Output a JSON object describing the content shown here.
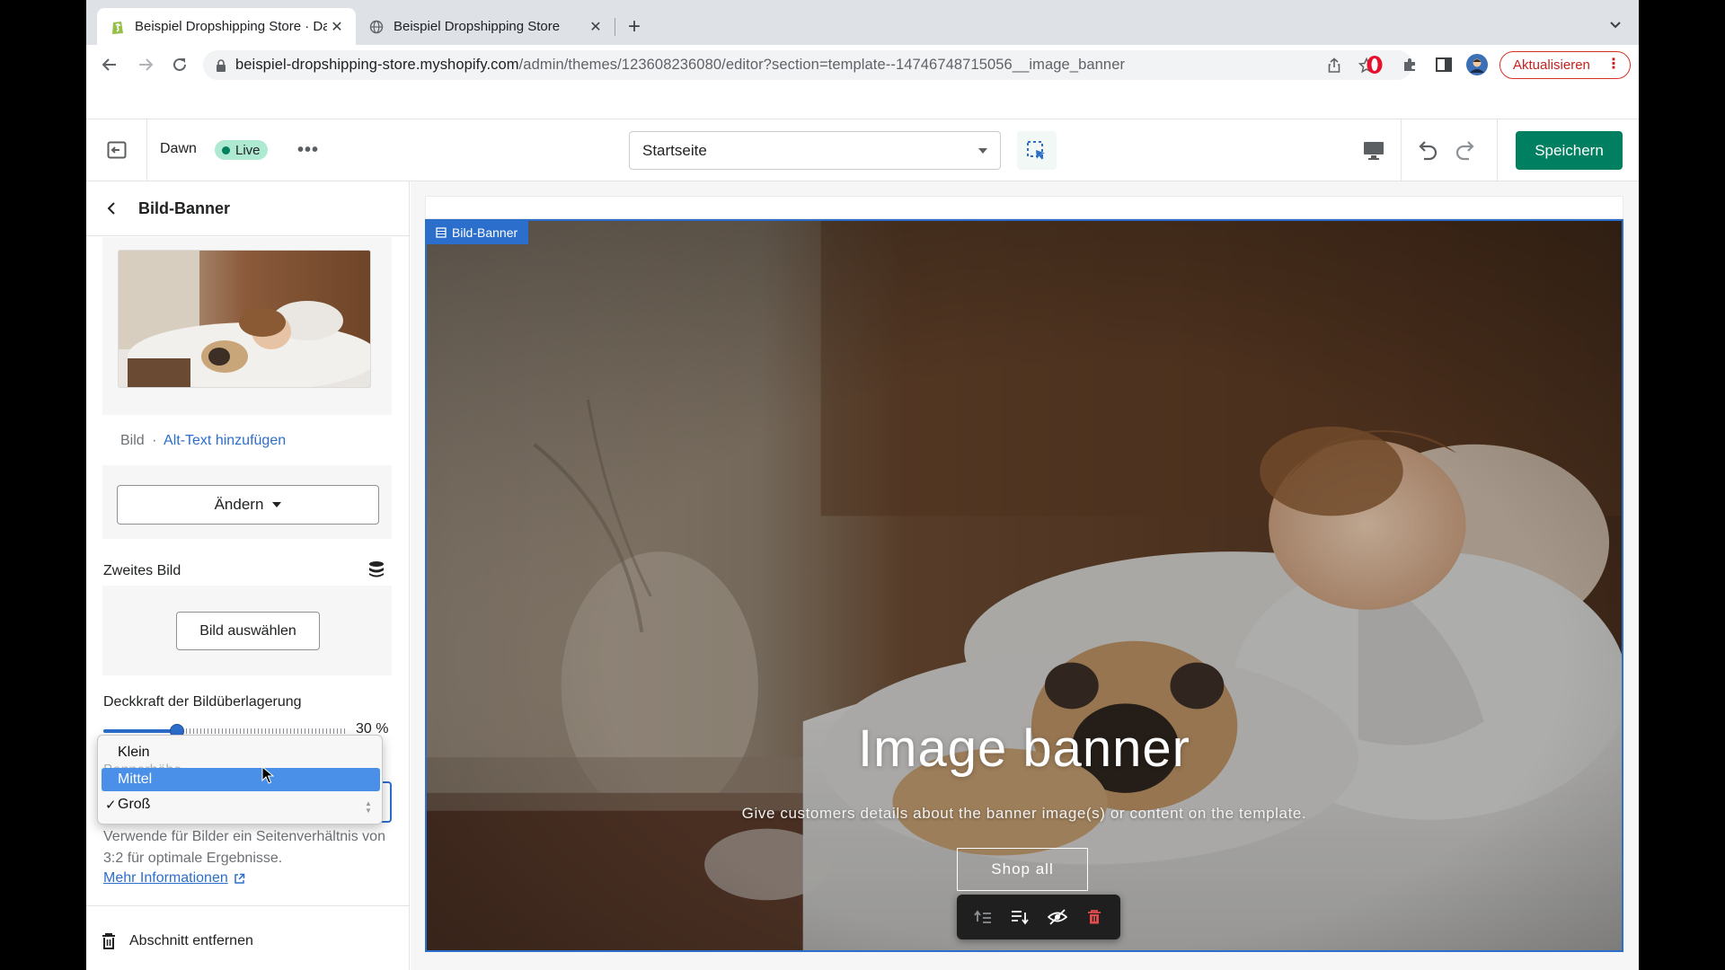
{
  "browser": {
    "tabs": [
      {
        "title": "Beispiel Dropshipping Store · Dawn",
        "active": true
      },
      {
        "title": "Beispiel Dropshipping Store",
        "active": false
      }
    ],
    "url_host": "beispiel-dropshipping-store.myshopify.com",
    "url_path": "/admin/themes/123608236080/editor?section=template--14746748715056__image_banner",
    "update_label": "Aktualisieren"
  },
  "editor": {
    "theme_name": "Dawn",
    "live_label": "Live",
    "page_select_value": "Startseite",
    "save_label": "Speichern"
  },
  "sidebar": {
    "title": "Bild-Banner",
    "image_meta_label": "Bild",
    "image_meta_sep": "·",
    "alt_text_link": "Alt-Text hinzufügen",
    "change_button": "Ändern",
    "second_image_label": "Zweites Bild",
    "select_image_button": "Bild auswählen",
    "opacity_label": "Deckkraft der Bildüberlagerung",
    "opacity_value_text": "30 %",
    "opacity_fraction": 0.3,
    "height_label": "Bannerhöhe",
    "height_help": "Verwende für Bilder ein Seitenverhältnis von 3:2 für optimale Ergebnisse.",
    "more_info_link": "Mehr Informationen",
    "remove_section": "Abschnitt entfernen"
  },
  "dropdown": {
    "options": [
      "Klein",
      "Mittel",
      "Groß"
    ],
    "highlighted": "Mittel",
    "selected": "Groß",
    "check_mark": "✓"
  },
  "preview": {
    "section_tag": "Bild-Banner",
    "heading": "Image banner",
    "text": "Give customers details about the banner image(s) or content on the template.",
    "button": "Shop all"
  },
  "colors": {
    "accent": "#2c6ecb",
    "save_green": "#008060",
    "live_bg": "#aee9d1",
    "update_red": "#d93025"
  },
  "icons": {
    "exit": "exit-icon",
    "inspector": "select-element-icon",
    "desktop": "desktop-icon",
    "undo": "undo-icon",
    "redo": "redo-icon",
    "stack": "dynamic-source-icon",
    "trash": "trash-icon"
  }
}
